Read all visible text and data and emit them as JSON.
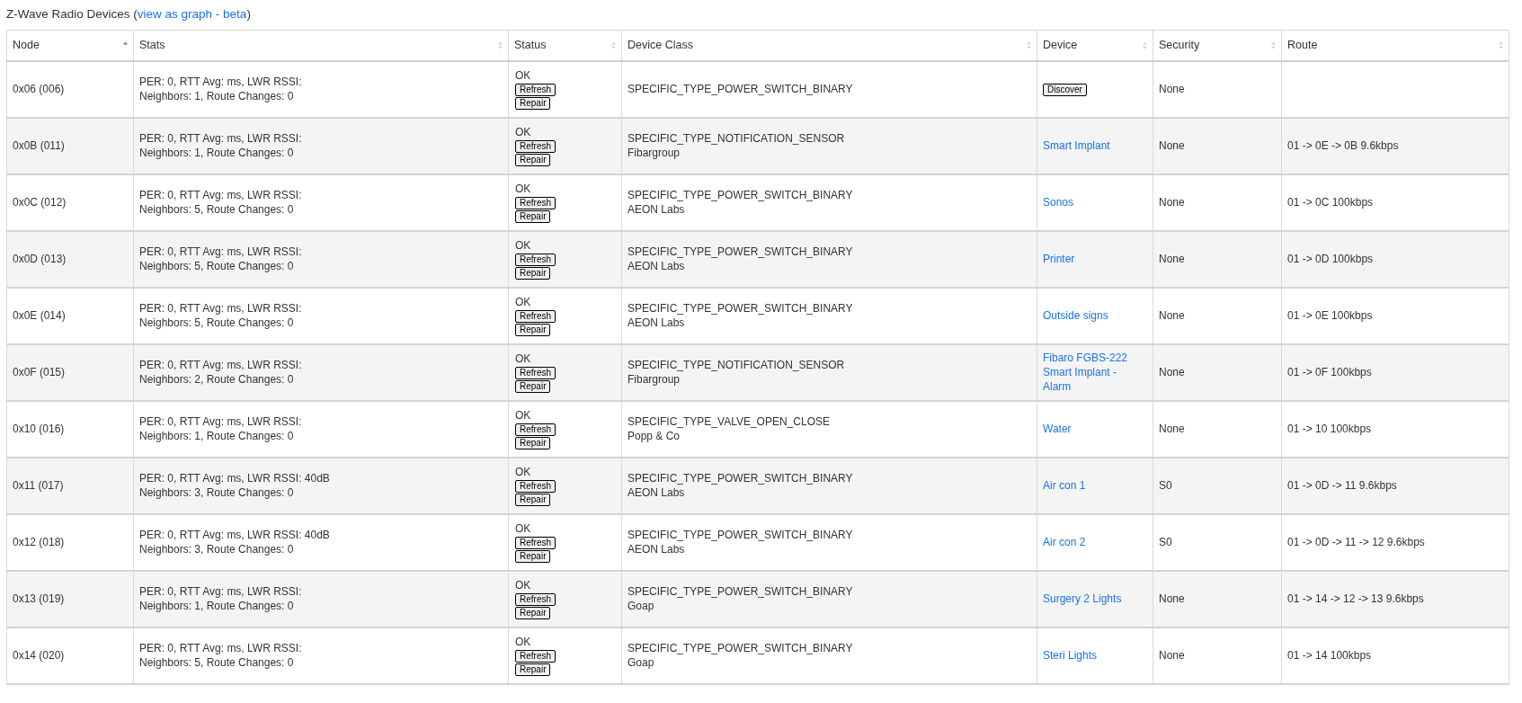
{
  "heading": {
    "title": "Z-Wave Radio Devices (",
    "link": "view as graph - beta",
    "close": ")"
  },
  "columns": [
    {
      "label": "Node",
      "sorted": true
    },
    {
      "label": "Stats",
      "sorted": false
    },
    {
      "label": "Status",
      "sorted": false
    },
    {
      "label": "Device Class",
      "sorted": false
    },
    {
      "label": "Device",
      "sorted": false
    },
    {
      "label": "Security",
      "sorted": false
    },
    {
      "label": "Route",
      "sorted": false
    }
  ],
  "rows": [
    {
      "node": "0x06 (006)",
      "stats": [
        "PER: 0, RTT Avg: ms, LWR RSSI:",
        "Neighbors: 1, Route Changes: 0"
      ],
      "status": "OK",
      "actions": [
        "Refresh",
        "Repair"
      ],
      "device_class": [
        "SPECIFIC_TYPE_POWER_SWITCH_BINARY"
      ],
      "device": {
        "kind": "button",
        "text": "Discover"
      },
      "security": "None",
      "route": ""
    },
    {
      "node": "0x0B (011)",
      "stats": [
        "PER: 0, RTT Avg: ms, LWR RSSI:",
        "Neighbors: 1, Route Changes: 0"
      ],
      "status": "OK",
      "actions": [
        "Refresh",
        "Repair"
      ],
      "device_class": [
        "SPECIFIC_TYPE_NOTIFICATION_SENSOR",
        "Fibargroup"
      ],
      "device": {
        "kind": "link",
        "text": "Smart Implant"
      },
      "security": "None",
      "route": "01 -> 0E -> 0B 9.6kbps"
    },
    {
      "node": "0x0C (012)",
      "stats": [
        "PER: 0, RTT Avg: ms, LWR RSSI:",
        "Neighbors: 5, Route Changes: 0"
      ],
      "status": "OK",
      "actions": [
        "Refresh",
        "Repair"
      ],
      "device_class": [
        "SPECIFIC_TYPE_POWER_SWITCH_BINARY",
        "AEON Labs"
      ],
      "device": {
        "kind": "link",
        "text": "Sonos"
      },
      "security": "None",
      "route": "01 -> 0C 100kbps"
    },
    {
      "node": "0x0D (013)",
      "stats": [
        "PER: 0, RTT Avg: ms, LWR RSSI:",
        "Neighbors: 5, Route Changes: 0"
      ],
      "status": "OK",
      "actions": [
        "Refresh",
        "Repair"
      ],
      "device_class": [
        "SPECIFIC_TYPE_POWER_SWITCH_BINARY",
        "AEON Labs"
      ],
      "device": {
        "kind": "link",
        "text": "Printer"
      },
      "security": "None",
      "route": "01 -> 0D 100kbps"
    },
    {
      "node": "0x0E (014)",
      "stats": [
        "PER: 0, RTT Avg: ms, LWR RSSI:",
        "Neighbors: 5, Route Changes: 0"
      ],
      "status": "OK",
      "actions": [
        "Refresh",
        "Repair"
      ],
      "device_class": [
        "SPECIFIC_TYPE_POWER_SWITCH_BINARY",
        "AEON Labs"
      ],
      "device": {
        "kind": "link",
        "text": "Outside signs"
      },
      "security": "None",
      "route": "01 -> 0E 100kbps"
    },
    {
      "node": "0x0F (015)",
      "stats": [
        "PER: 0, RTT Avg: ms, LWR RSSI:",
        "Neighbors: 2, Route Changes: 0"
      ],
      "status": "OK",
      "actions": [
        "Refresh",
        "Repair"
      ],
      "device_class": [
        "SPECIFIC_TYPE_NOTIFICATION_SENSOR",
        "Fibargroup"
      ],
      "device": {
        "kind": "link",
        "text": "Fibaro FGBS-222 Smart Implant - Alarm"
      },
      "security": "None",
      "route": "01 -> 0F 100kbps"
    },
    {
      "node": "0x10 (016)",
      "stats": [
        "PER: 0, RTT Avg: ms, LWR RSSI:",
        "Neighbors: 1, Route Changes: 0"
      ],
      "status": "OK",
      "actions": [
        "Refresh",
        "Repair"
      ],
      "device_class": [
        "SPECIFIC_TYPE_VALVE_OPEN_CLOSE",
        "Popp & Co"
      ],
      "device": {
        "kind": "link",
        "text": "Water"
      },
      "security": "None",
      "route": "01 -> 10 100kbps"
    },
    {
      "node": "0x11 (017)",
      "stats": [
        "PER: 0, RTT Avg: ms, LWR RSSI: 40dB",
        "Neighbors: 3, Route Changes: 0"
      ],
      "status": "OK",
      "actions": [
        "Refresh",
        "Repair"
      ],
      "device_class": [
        "SPECIFIC_TYPE_POWER_SWITCH_BINARY",
        "AEON Labs"
      ],
      "device": {
        "kind": "link",
        "text": "Air con 1"
      },
      "security": "S0",
      "route": "01 -> 0D -> 11 9.6kbps"
    },
    {
      "node": "0x12 (018)",
      "stats": [
        "PER: 0, RTT Avg: ms, LWR RSSI: 40dB",
        "Neighbors: 3, Route Changes: 0"
      ],
      "status": "OK",
      "actions": [
        "Refresh",
        "Repair"
      ],
      "device_class": [
        "SPECIFIC_TYPE_POWER_SWITCH_BINARY",
        "AEON Labs"
      ],
      "device": {
        "kind": "link",
        "text": "Air con 2"
      },
      "security": "S0",
      "route": "01 -> 0D -> 11 -> 12 9.6kbps"
    },
    {
      "node": "0x13 (019)",
      "stats": [
        "PER: 0, RTT Avg: ms, LWR RSSI:",
        "Neighbors: 1, Route Changes: 0"
      ],
      "status": "OK",
      "actions": [
        "Refresh",
        "Repair"
      ],
      "device_class": [
        "SPECIFIC_TYPE_POWER_SWITCH_BINARY",
        "Goap"
      ],
      "device": {
        "kind": "link",
        "text": "Surgery 2 Lights"
      },
      "security": "None",
      "route": "01 -> 14 -> 12 -> 13 9.6kbps"
    },
    {
      "node": "0x14 (020)",
      "stats": [
        "PER: 0, RTT Avg: ms, LWR RSSI:",
        "Neighbors: 5, Route Changes: 0"
      ],
      "status": "OK",
      "actions": [
        "Refresh",
        "Repair"
      ],
      "device_class": [
        "SPECIFIC_TYPE_POWER_SWITCH_BINARY",
        "Goap"
      ],
      "device": {
        "kind": "link",
        "text": "Steri Lights"
      },
      "security": "None",
      "route": "01 -> 14 100kbps"
    }
  ]
}
